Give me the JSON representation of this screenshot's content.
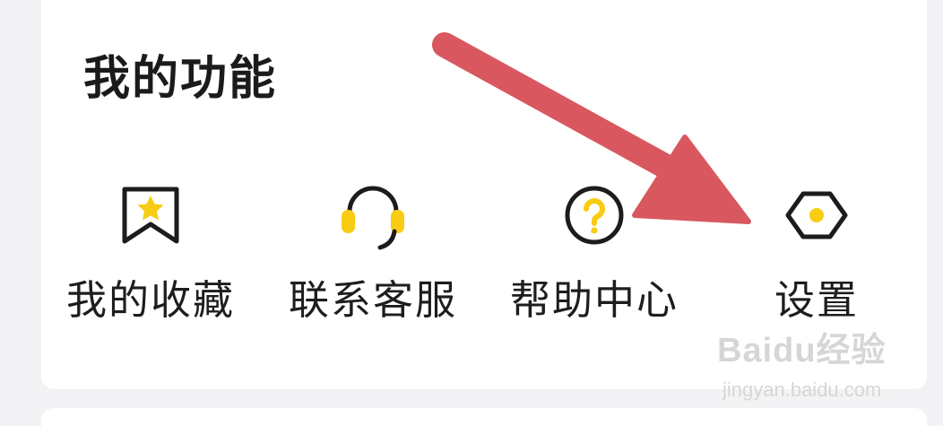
{
  "section": {
    "title": "我的功能"
  },
  "features": [
    {
      "label": "我的收藏",
      "icon": "bookmark-star-icon"
    },
    {
      "label": "联系客服",
      "icon": "headset-icon"
    },
    {
      "label": "帮助中心",
      "icon": "help-circle-icon"
    },
    {
      "label": "设置",
      "icon": "settings-hexagon-icon"
    }
  ],
  "watermark": {
    "brand": "Baidu经验",
    "url": "jingyan.baidu.com"
  },
  "colors": {
    "accent_yellow": "#f7cc12",
    "icon_stroke": "#1c1c1c",
    "annotation_arrow": "#d9575f",
    "background": "#f3f3f5",
    "card": "#ffffff"
  }
}
